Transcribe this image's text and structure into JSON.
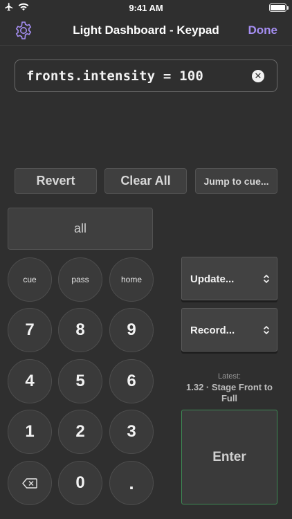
{
  "status_bar": {
    "time": "9:41 AM"
  },
  "nav": {
    "title": "Light Dashboard - Keypad",
    "done_label": "Done"
  },
  "command": {
    "text": "fronts.intensity = 100"
  },
  "tools": {
    "revert": "Revert",
    "clear_all": "Clear All",
    "jump_to_cue": "Jump to cue..."
  },
  "all_button": "all",
  "keypad": {
    "cue": "cue",
    "pass": "pass",
    "home": "home",
    "k7": "7",
    "k8": "8",
    "k9": "9",
    "k4": "4",
    "k5": "5",
    "k6": "6",
    "k1": "1",
    "k2": "2",
    "k3": "3",
    "k0": "0",
    "dot": "."
  },
  "actions": {
    "update": "Update...",
    "record": "Record...",
    "latest_label": "Latest:",
    "latest_value": "1.32 · Stage Front to Full",
    "enter": "Enter"
  },
  "colors": {
    "accent": "#a58ef2",
    "enter_border": "#3e8a54",
    "background": "#2f2f2f"
  },
  "icons": [
    "airplane-icon",
    "wifi-icon",
    "battery-icon",
    "gear-icon",
    "clear-icon",
    "backspace-icon",
    "chevron-updown-icon"
  ]
}
